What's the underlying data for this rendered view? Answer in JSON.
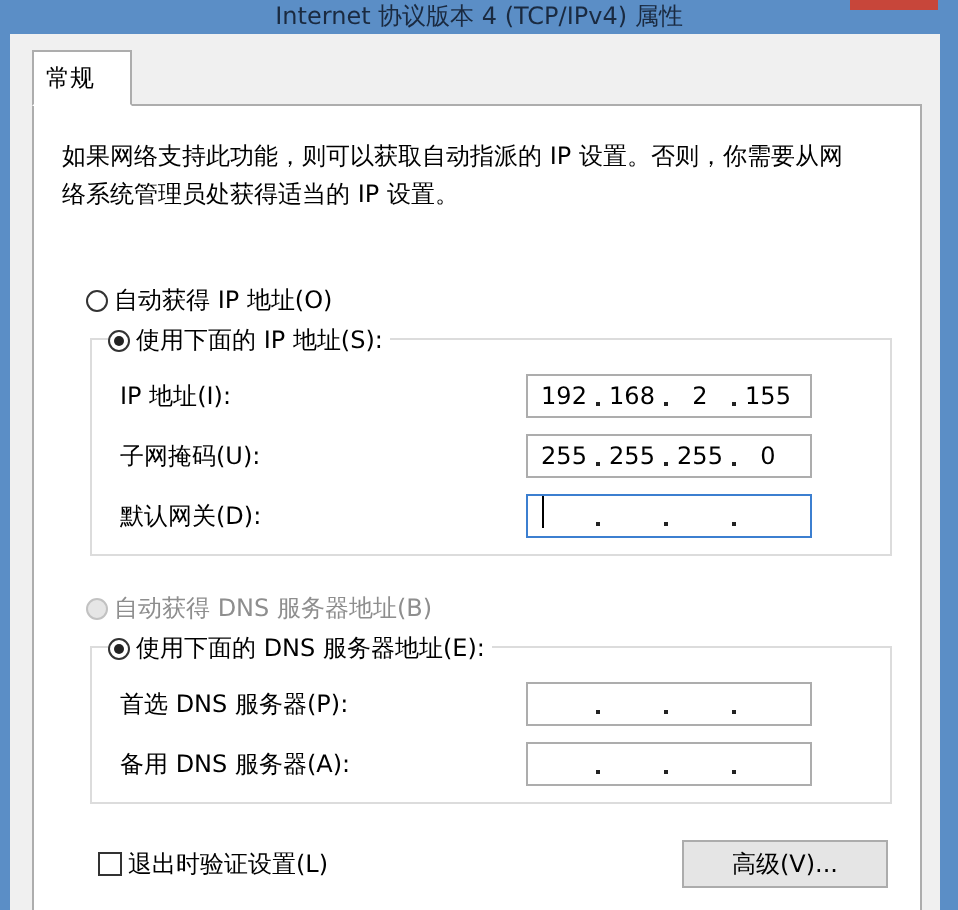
{
  "window": {
    "title": "Internet 协议版本 4 (TCP/IPv4) 属性"
  },
  "tabs": [
    {
      "label": "常规",
      "selected": true
    }
  ],
  "description": "如果网络支持此功能，则可以获取自动指派的 IP 设置。否则，你需要从网络系统管理员处获得适当的 IP 设置。",
  "ip_section": {
    "auto_radio": {
      "label": "自动获得 IP 地址(O)",
      "selected": false,
      "disabled": false
    },
    "manual_radio": {
      "label": "使用下面的 IP 地址(S):",
      "selected": true,
      "disabled": false
    },
    "fields": [
      {
        "label": "IP 地址(I):",
        "octets": [
          "192",
          "168",
          "2",
          "155"
        ],
        "focused": false
      },
      {
        "label": "子网掩码(U):",
        "octets": [
          "255",
          "255",
          "255",
          "0"
        ],
        "focused": false
      },
      {
        "label": "默认网关(D):",
        "focused": true
      }
    ]
  },
  "dns_section": {
    "auto_radio": {
      "label": "自动获得 DNS 服务器地址(B)",
      "selected": false,
      "disabled": true
    },
    "manual_radio": {
      "label": "使用下面的 DNS 服务器地址(E):",
      "selected": true,
      "disabled": false
    },
    "fields": [
      {
        "label": "首选 DNS 服务器(P):",
        "focused": false
      },
      {
        "label": "备用 DNS 服务器(A):",
        "focused": false
      }
    ]
  },
  "validate_checkbox": {
    "label": "退出时验证设置(L)",
    "checked": false
  },
  "buttons": [
    {
      "label": "高级(V)..."
    }
  ]
}
